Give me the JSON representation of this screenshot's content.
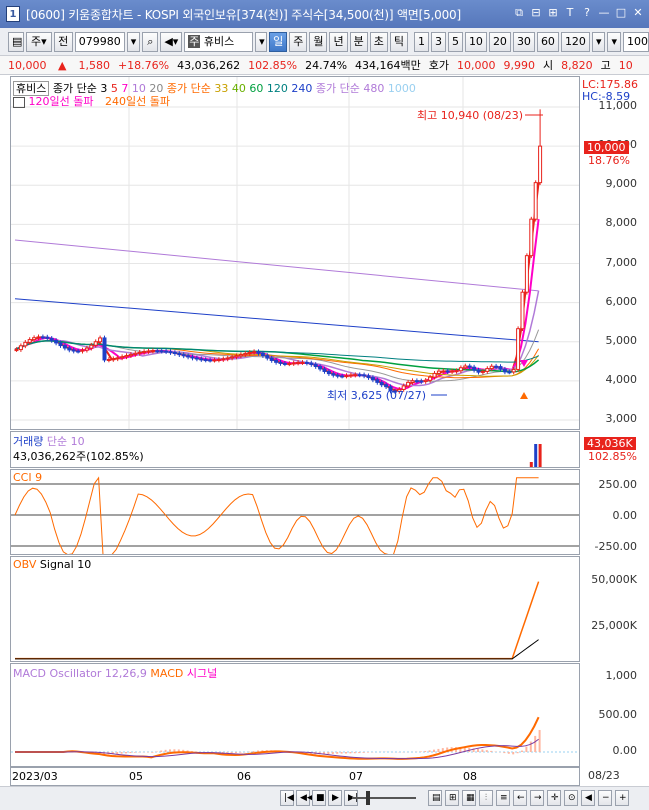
{
  "window": {
    "title": "[0600] 키움종합차트 - KOSPI 외국인보유[374(천)] 주식수[34,500(천)] 액면[5,000]",
    "app_badge": "1",
    "buttons": [
      "⧉",
      "⊟",
      "⊞",
      "T",
      "?",
      "—",
      "□",
      "✕"
    ]
  },
  "toolbar": {
    "type1": "주",
    "type2": "전",
    "code": "079980",
    "name": "휴비스",
    "name_prefix": "주",
    "periods": [
      "일",
      "주",
      "월",
      "년",
      "분",
      "초",
      "틱"
    ],
    "selected_period": "일",
    "intervals": [
      "1",
      "3",
      "5",
      "10",
      "20",
      "30",
      "60",
      "120"
    ],
    "count": "100"
  },
  "quote": {
    "price": "10,000",
    "arrow": "▲",
    "change": "1,580",
    "change_pct": "+18.76%",
    "volume": "43,036,262",
    "vol_ratio": "102.85%",
    "turnover": "24.74%",
    "amount": "434,164백만",
    "ask_label": "호가",
    "ask1": "10,000",
    "ask2": "9,990",
    "open_label": "시",
    "open": "8,820",
    "high_label": "고",
    "high": "10"
  },
  "price_pane": {
    "legend1": [
      "휴비스",
      "종가 단순",
      "3",
      "5",
      "7",
      "10",
      "20",
      "종가 단순",
      "33",
      "40",
      "60",
      "120",
      "240",
      "종가 단순",
      "480",
      "1000"
    ],
    "legend2": [
      "120일선 돌파",
      "240일선 돌파"
    ],
    "lc": "LC:175.86",
    "hc": "HC:-8.59",
    "high_note": "최고 10,940 (08/23)",
    "low_note": "최저 3,625 (07/27)",
    "current_tag": "10,000",
    "current_pct": "18.76%",
    "yticks": [
      "11,000",
      "10,000",
      "9,000",
      "8,000",
      "7,000",
      "6,000",
      "5,000",
      "4,000",
      "3,000"
    ]
  },
  "volume_pane": {
    "title": "거래량",
    "ma": "단순 10",
    "value": "43,036,262주(102.85%)",
    "tag": "43,036K",
    "tag_pct": "102.85%"
  },
  "cci_pane": {
    "title": "CCI 9",
    "yticks": [
      "250.00",
      "0.00",
      "-250.00"
    ]
  },
  "obv_pane": {
    "title": "OBV",
    "signal": "Signal 10",
    "yticks": [
      "50,000K",
      "25,000K"
    ]
  },
  "macd_pane": {
    "title": "MACD Oscillator 12,26,9",
    "macd": "MACD",
    "signal": "시그널",
    "yticks": [
      "1,000",
      "500.00",
      "0.00"
    ]
  },
  "xaxis": {
    "labels": [
      "2023/03",
      "05",
      "06",
      "07",
      "08"
    ],
    "right": "08/23"
  },
  "colors": {
    "up": "#e8231c",
    "down": "#1e40c8",
    "ma3": "#e8231c",
    "ma5": "#ff00c8",
    "ma10": "#b07ad8",
    "obv": "#ff6a00",
    "macd_osc": "#ffb6a0"
  }
}
